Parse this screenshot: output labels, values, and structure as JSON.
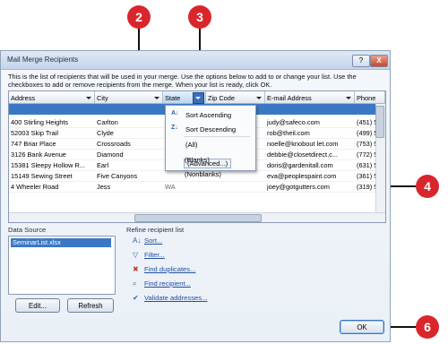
{
  "dialog": {
    "title": "Mail Merge Recipients",
    "help_label": "?",
    "close_label": "X",
    "intro_line1": "This is the list of recipients that will be used in your merge.  Use the options below to add to or change your list.  Use the",
    "intro_line2": "checkboxes to add or remove recipients from the merge.  When your list is ready, click OK."
  },
  "columns": [
    "Address",
    "City",
    "State",
    "Zip Code",
    "E-mail Address",
    "Phone"
  ],
  "rows": [
    {
      "address": "400 Stirling Heights",
      "city": "Carlton",
      "email": "judy@safeco.com",
      "phone": "(451) 5"
    },
    {
      "address": "52003 Skip Trail",
      "city": "Clyde",
      "email": "rob@theil.com",
      "phone": "(499) 5"
    },
    {
      "address": "747 Briar Place",
      "city": "Crossroads",
      "email": "noelle@knobout let.com",
      "phone": "(753) 5"
    },
    {
      "address": "3126 Bank Avenue",
      "city": "Diamond",
      "email": "debbie@closetdirect.c...",
      "phone": "(772) 5"
    },
    {
      "address": "15381 Sleepy Hollow R...",
      "city": "Earl",
      "email": "doris@gardenitall.com",
      "phone": "(631) 5"
    },
    {
      "address": "15149 Sewing Street",
      "city": "Five Canyons",
      "email": "eva@peoplespaint.com",
      "phone": "(361) 5"
    },
    {
      "address": "4 Wheeler Road",
      "city": "Jess",
      "email": "joey@gotgutters.com",
      "phone": "(319) 5"
    }
  ],
  "partial_state": "WA",
  "filter_menu": {
    "sort_ascending": "Sort Ascending",
    "sort_descending": "Sort Descending",
    "all": "(All)",
    "blanks": "(Blanks)",
    "nonblanks": "(Nonblanks)",
    "advanced": "(Advanced...)"
  },
  "data_source": {
    "label": "Data Source",
    "file": "SeminarList.xlsx",
    "edit_label": "Edit...",
    "refresh_label": "Refresh"
  },
  "refine": {
    "label": "Refine recipient list",
    "sort": "Sort...",
    "filter": "Filter...",
    "find_duplicates": "Find duplicates...",
    "find_recipient": "Find recipient...",
    "validate": "Validate addresses..."
  },
  "ok_label": "OK",
  "callouts": [
    "2",
    "3",
    "4",
    "6"
  ],
  "colors": {
    "callout": "#d9262d",
    "selection": "#3b78c4",
    "link": "#1f4fa3"
  }
}
